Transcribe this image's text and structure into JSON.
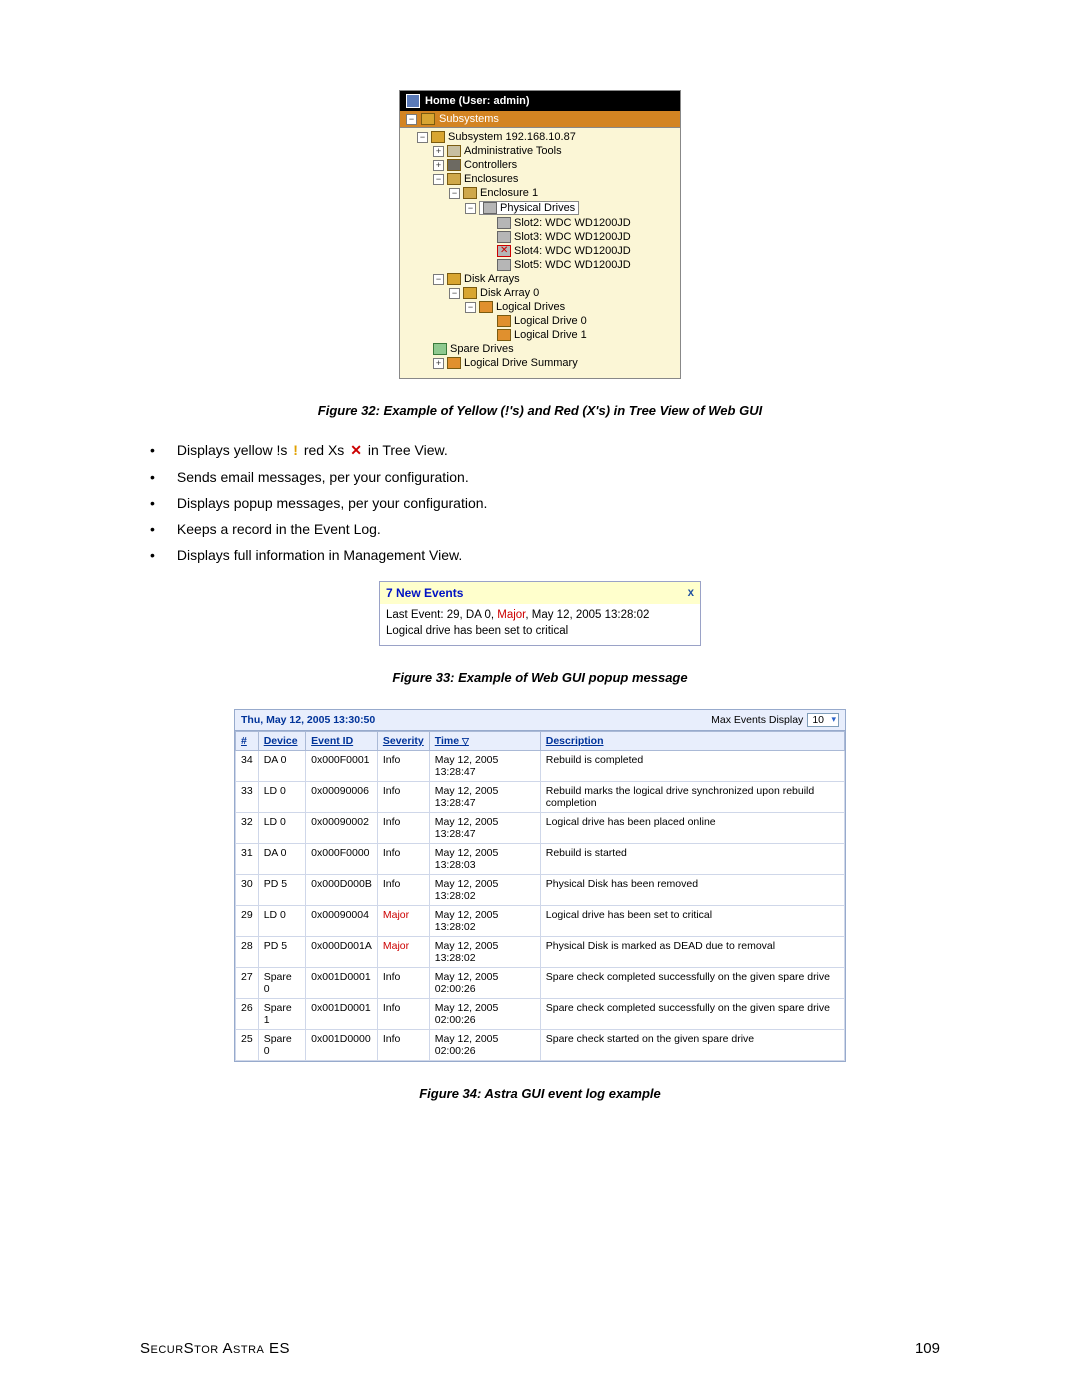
{
  "tree": {
    "header": "Home (User: admin)",
    "subsystems_label": "Subsystems",
    "subsystem_ip": "Subsystem 192.168.10.87",
    "admin_tools": "Administrative Tools",
    "controllers": "Controllers",
    "enclosures": "Enclosures",
    "enclosure1": "Enclosure 1",
    "physical_drives": "Physical Drives",
    "slots": [
      "Slot2: WDC WD1200JD",
      "Slot3: WDC WD1200JD",
      "Slot4: WDC WD1200JD",
      "Slot5: WDC WD1200JD"
    ],
    "disk_arrays": "Disk Arrays",
    "disk_array0": "Disk Array 0",
    "logical_drives": "Logical Drives",
    "ld0": "Logical Drive 0",
    "ld1": "Logical Drive 1",
    "spare_drives": "Spare Drives",
    "ld_summary": "Logical Drive Summary"
  },
  "caption32": "Figure 32: Example of Yellow (!'s) and Red (X's) in Tree View of Web GUI",
  "bullets": {
    "b1a": "Displays yellow !s ",
    "b1b": " red Xs ",
    "b1c": " in Tree View.",
    "b2": "Sends email messages, per your configuration.",
    "b3": "Displays popup messages, per your configuration.",
    "b4": "Keeps a record in the Event Log.",
    "b5": "Displays full information in Management View."
  },
  "popup": {
    "title": "7 New Events",
    "close": "x",
    "line1a": "Last Event: 29, DA 0, ",
    "line1_sev": "Major",
    "line1b": ", May 12, 2005 13:28:02",
    "line2": "Logical drive has been set to critical"
  },
  "caption33": "Figure 33: Example of Web GUI popup message",
  "evt": {
    "timestamp": "Thu, May 12, 2005 13:30:50",
    "max_label": "Max Events Display",
    "max_value": "10",
    "cols": {
      "num": "#",
      "device": "Device",
      "eventid": "Event ID",
      "severity": "Severity",
      "time": "Time",
      "desc": "Description"
    },
    "rows": [
      {
        "n": "34",
        "dev": "DA 0",
        "eid": "0x000F0001",
        "sev": "Info",
        "t": "May 12, 2005 13:28:47",
        "d": "Rebuild is completed"
      },
      {
        "n": "33",
        "dev": "LD 0",
        "eid": "0x00090006",
        "sev": "Info",
        "t": "May 12, 2005 13:28:47",
        "d": "Rebuild marks the logical drive synchronized upon rebuild completion"
      },
      {
        "n": "32",
        "dev": "LD 0",
        "eid": "0x00090002",
        "sev": "Info",
        "t": "May 12, 2005 13:28:47",
        "d": "Logical drive has been placed online"
      },
      {
        "n": "31",
        "dev": "DA 0",
        "eid": "0x000F0000",
        "sev": "Info",
        "t": "May 12, 2005 13:28:03",
        "d": "Rebuild is started"
      },
      {
        "n": "30",
        "dev": "PD 5",
        "eid": "0x000D000B",
        "sev": "Info",
        "t": "May 12, 2005 13:28:02",
        "d": "Physical Disk has been removed"
      },
      {
        "n": "29",
        "dev": "LD 0",
        "eid": "0x00090004",
        "sev": "Major",
        "t": "May 12, 2005 13:28:02",
        "d": "Logical drive has been set to critical"
      },
      {
        "n": "28",
        "dev": "PD 5",
        "eid": "0x000D001A",
        "sev": "Major",
        "t": "May 12, 2005 13:28:02",
        "d": "Physical Disk is marked as DEAD due to removal"
      },
      {
        "n": "27",
        "dev": "Spare 0",
        "eid": "0x001D0001",
        "sev": "Info",
        "t": "May 12, 2005 02:00:26",
        "d": "Spare check completed successfully on the given spare drive"
      },
      {
        "n": "26",
        "dev": "Spare 1",
        "eid": "0x001D0001",
        "sev": "Info",
        "t": "May 12, 2005 02:00:26",
        "d": "Spare check completed successfully on the given spare drive"
      },
      {
        "n": "25",
        "dev": "Spare 0",
        "eid": "0x001D0000",
        "sev": "Info",
        "t": "May 12, 2005 02:00:26",
        "d": "Spare check started on the given spare drive"
      }
    ]
  },
  "caption34": "Figure 34: Astra GUI event log example",
  "footer": {
    "left": "SecurStor Astra ES",
    "right": "109"
  }
}
